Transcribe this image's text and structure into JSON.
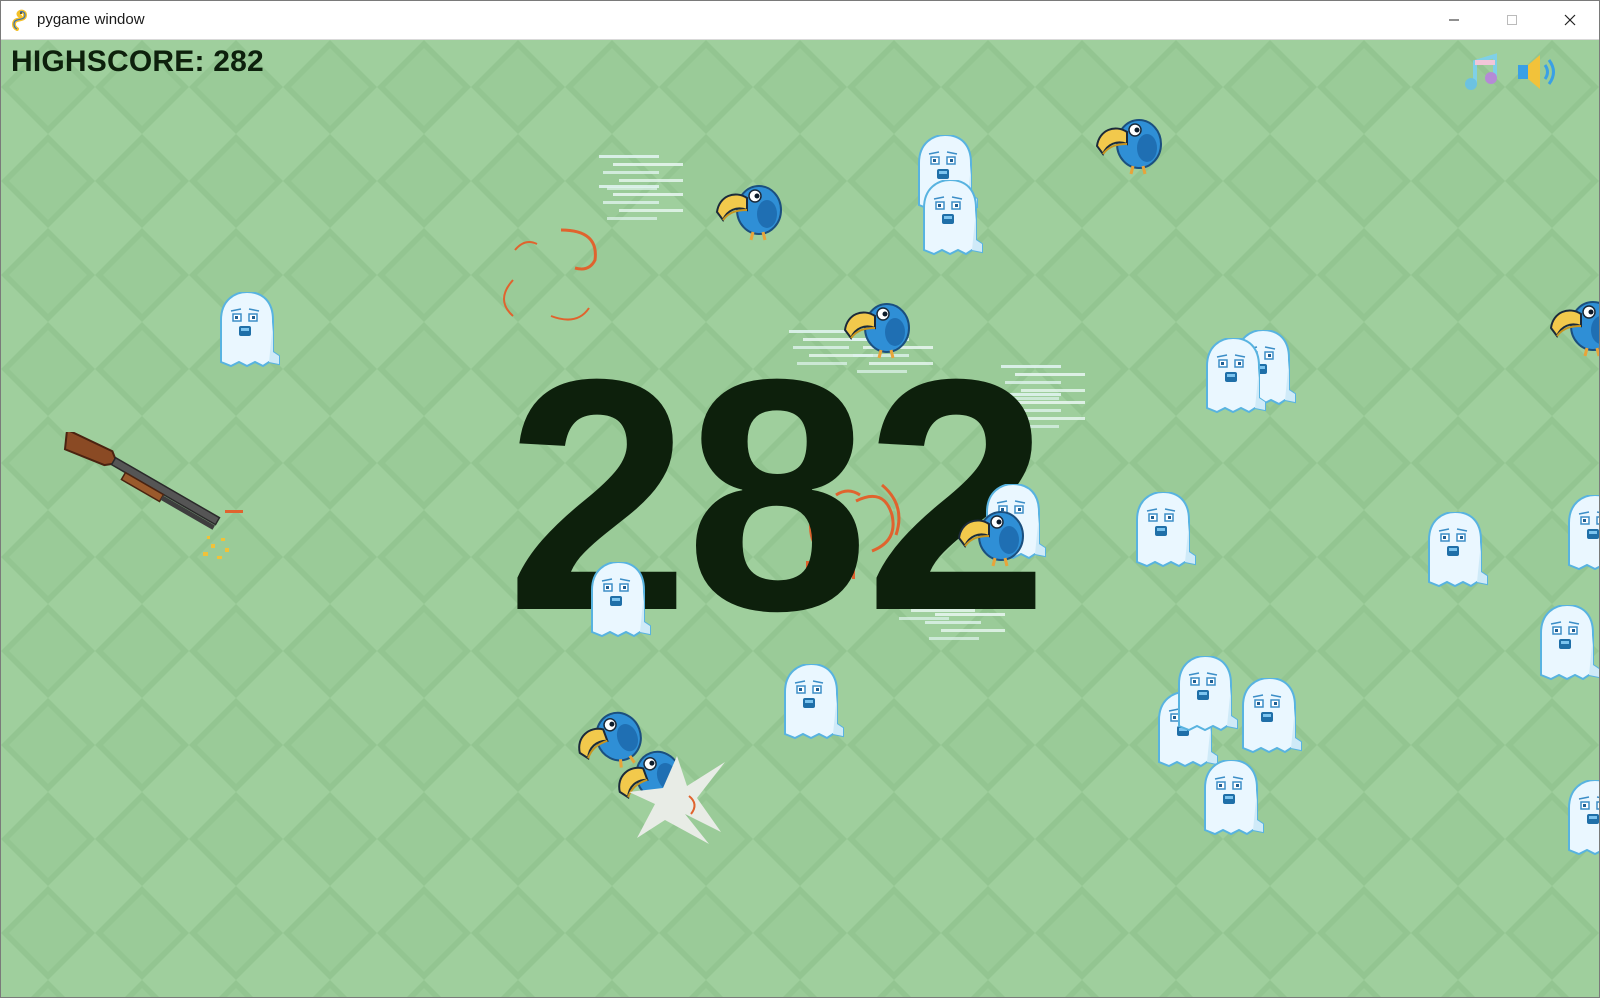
{
  "window": {
    "title": "pygame window",
    "controls": [
      "minimize-icon",
      "maximize-icon",
      "close-icon"
    ]
  },
  "hud": {
    "highscore_label": "HIGHSCORE: 282",
    "score": "282",
    "icons": [
      "music-toggle-icon",
      "sound-toggle-icon"
    ]
  },
  "colors": {
    "background_light": "#9fcf9d",
    "background_dark": "#93c591",
    "text": "#0d200c",
    "ghost_body": "#e8f6ff",
    "ghost_outline": "#4aa9dc",
    "bird_body": "#2f8fd6",
    "bird_beak": "#f2c94c",
    "gun_wood": "#8a4a24",
    "gun_metal": "#555555",
    "explosion": "#e0632e"
  },
  "entities": {
    "ghost_count": 17,
    "bird_count": 8,
    "weapon": "shotgun"
  }
}
